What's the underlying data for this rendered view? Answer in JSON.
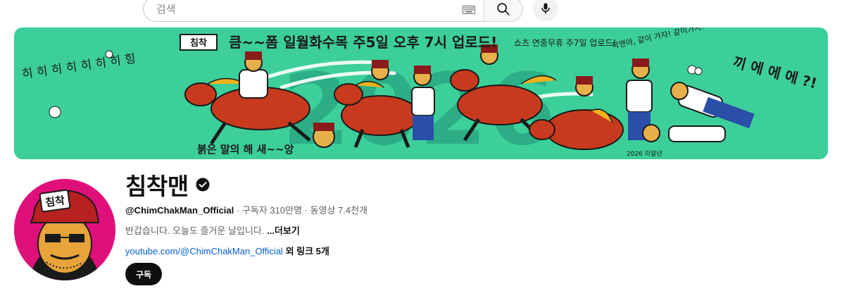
{
  "search": {
    "placeholder": "검색"
  },
  "banner": {
    "headline": "큼~~폼 일월화수목 주5일 오후 7시 업로드!",
    "shorts_note": "쇼츠 연중무휴 주7일 업로드!",
    "logo_text": "침착",
    "left_laugh": "히 히 히 히 히 히 히 힝",
    "bottom_text": "붉은 말의 해 새~~앙",
    "right_shout": "끼 에 에 에 ?!",
    "speech_bubble": "착맨아, 같이 가자! 같이가자!",
    "year_graffiti": "2026",
    "signature": "2026 이말년",
    "background_color": "#3ccf9a"
  },
  "channel": {
    "title": "침착맨",
    "handle": "@ChimChakMan_Official",
    "separator": " · ",
    "subscribers": "구독자 310만명",
    "videos": "동영상 7.4천개",
    "description": "반갑습니다. 오늘도 즐거운 날입니다.",
    "more_label": "...더보기",
    "link": "youtube.com/@ChimChakMan_Official",
    "link_extra": " 외 링크 5개",
    "subscribe_label": "구독",
    "avatar_label": "침착"
  },
  "icons": {
    "keyboard": "keyboard-icon",
    "search": "search-icon",
    "mic": "microphone-icon",
    "verified": "verified-check-icon"
  },
  "colors": {
    "accent_blue": "#065fd4",
    "subscribe_bg": "#0f0f0f",
    "avatar_bg": "#e0107a",
    "horse_red": "#c83a1e"
  }
}
